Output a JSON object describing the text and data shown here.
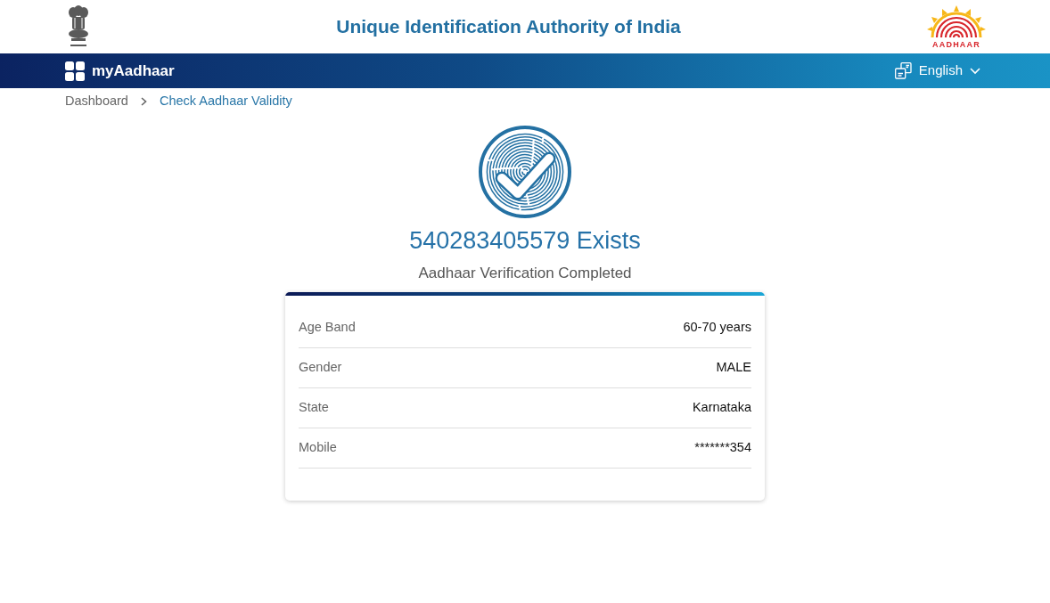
{
  "header": {
    "title": "Unique Identification Authority of India",
    "logo_text": "AADHAAR"
  },
  "navbar": {
    "brand": "myAadhaar",
    "language": "English"
  },
  "breadcrumb": [
    {
      "label": "Dashboard",
      "current": false
    },
    {
      "label": "Check Aadhaar Validity",
      "current": true
    }
  ],
  "result": {
    "heading": "540283405579 Exists",
    "subheading": "Aadhaar Verification Completed"
  },
  "details": [
    {
      "label": "Age Band",
      "value": "60-70 years"
    },
    {
      "label": "Gender",
      "value": "MALE"
    },
    {
      "label": "State",
      "value": "Karnataka"
    },
    {
      "label": "Mobile",
      "value": "*******354"
    }
  ]
}
